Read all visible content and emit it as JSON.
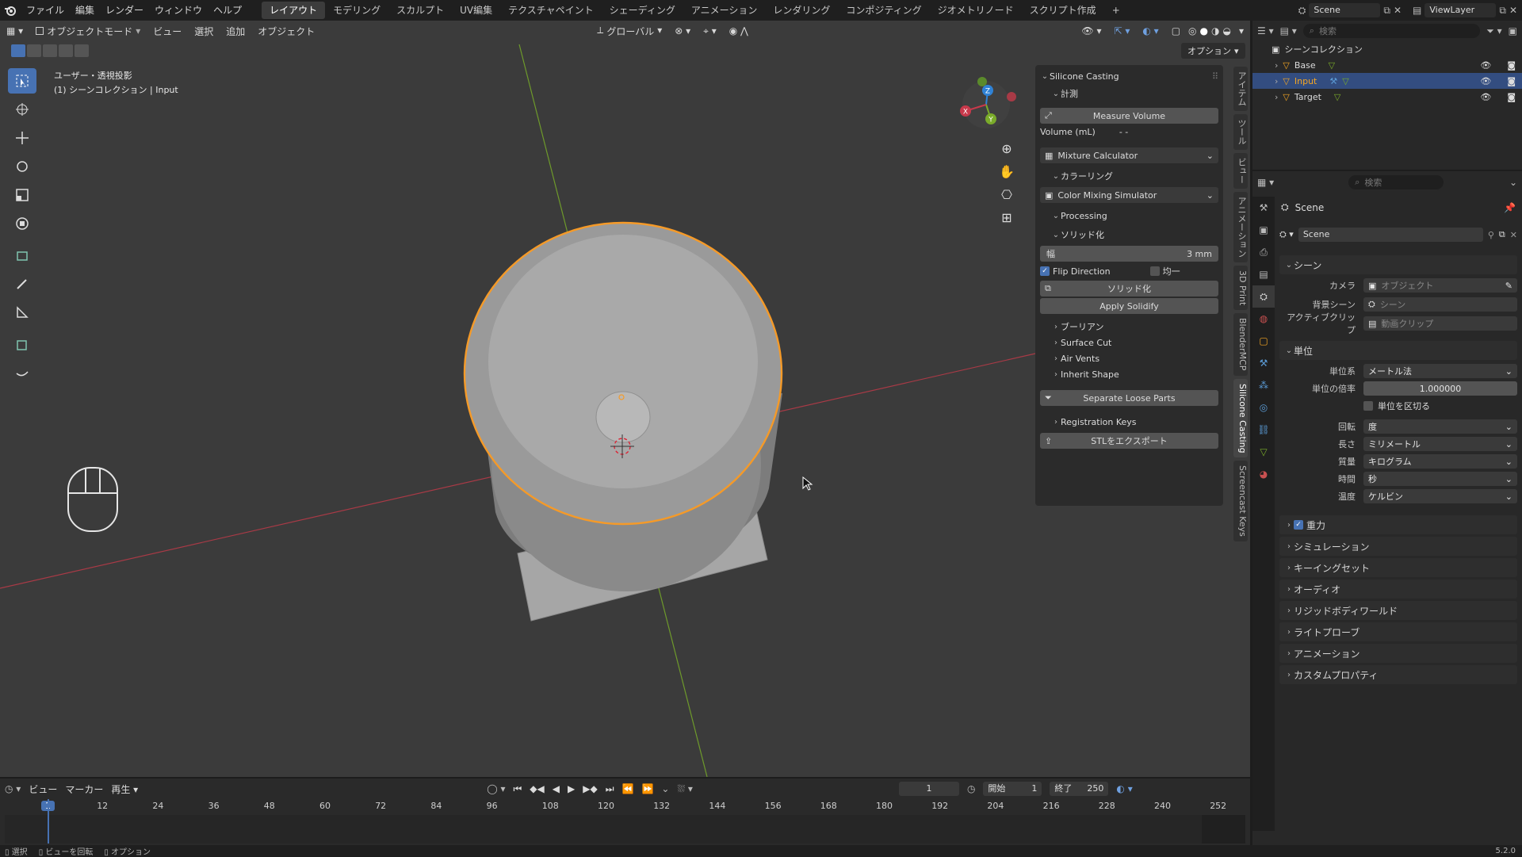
{
  "app": {
    "version": "5.2.0"
  },
  "menus": [
    "ファイル",
    "編集",
    "レンダー",
    "ウィンドウ",
    "ヘルプ"
  ],
  "workspaces": [
    "レイアウト",
    "モデリング",
    "スカルプト",
    "UV編集",
    "テクスチャペイント",
    "シェーディング",
    "アニメーション",
    "レンダリング",
    "コンポジティング",
    "ジオメトリノード",
    "スクリプト作成"
  ],
  "scene_selector": {
    "scene": "Scene",
    "view_layer": "ViewLayer"
  },
  "viewport": {
    "mode": "オブジェクトモード",
    "menus": [
      "ビュー",
      "選択",
      "追加",
      "オブジェクト"
    ],
    "transform_orientation": "グローバル",
    "options_label": "オプション",
    "overlay_line1": "ユーザー・透視投影",
    "overlay_line2": "(1) シーンコレクション | Input",
    "axes": {
      "x": "X",
      "y": "Y",
      "z": "Z"
    }
  },
  "npanel": {
    "title": "Silicone Casting",
    "sections": {
      "measure": "計測",
      "measure_button": "Measure Volume",
      "volume_label": "Volume (mL)",
      "volume_value": "- -",
      "mixture": "Mixture Calculator",
      "coloring": "カラーリング",
      "color_sim": "Color Mixing Simulator",
      "processing": "Processing",
      "solidify": "ソリッド化",
      "width_label": "幅",
      "width_value": "3 mm",
      "flip_direction": "Flip Direction",
      "uniform": "均一",
      "solidify_button": "ソリッド化",
      "apply_solidify": "Apply Solidify",
      "boolean": "ブーリアン",
      "surface_cut": "Surface Cut",
      "air_vents": "Air Vents",
      "inherit_shape": "Inherit Shape",
      "separate_loose": "Separate Loose Parts",
      "registration_keys": "Registration Keys",
      "stl_export": "STLをエクスポート"
    },
    "tabs": [
      "アイテム",
      "ツール",
      "ビュー",
      "アニメーション",
      "3D Print",
      "BlenderMCP",
      "Silicone Casting",
      "Screencast Keys"
    ]
  },
  "outliner": {
    "search_placeholder": "検索",
    "collection": "シーンコレクション",
    "items": [
      "Base",
      "Input",
      "Target"
    ]
  },
  "properties": {
    "search_placeholder": "検索",
    "breadcrumb": "Scene",
    "scene_name": "Scene",
    "scene_section": "シーン",
    "camera_label": "カメラ",
    "camera_value": "オブジェクト",
    "bg_scene_label": "背景シーン",
    "bg_scene_value": "シーン",
    "active_clip_label": "アクティブクリップ",
    "active_clip_value": "動画クリップ",
    "units_section": "単位",
    "unit_system_label": "単位系",
    "unit_system_value": "メートル法",
    "unit_scale_label": "単位の倍率",
    "unit_scale_value": "1.000000",
    "separate_units": "単位を区切る",
    "rotation_label": "回転",
    "rotation_value": "度",
    "length_label": "長さ",
    "length_value": "ミリメートル",
    "mass_label": "質量",
    "mass_value": "キログラム",
    "time_label": "時間",
    "time_value": "秒",
    "temperature_label": "温度",
    "temperature_value": "ケルビン",
    "collapsed": [
      "重力",
      "シミュレーション",
      "キーイングセット",
      "オーディオ",
      "リジッドボディワールド",
      "ライトプローブ",
      "アニメーション",
      "カスタムプロパティ"
    ]
  },
  "timeline": {
    "menus": [
      "ビュー",
      "マーカー",
      "再生"
    ],
    "current_frame": "1",
    "start_label": "開始",
    "start": "1",
    "end_label": "終了",
    "end": "250",
    "ticks": [
      "1",
      "12",
      "24",
      "36",
      "48",
      "60",
      "72",
      "84",
      "96",
      "108",
      "120",
      "132",
      "144",
      "156",
      "168",
      "180",
      "192",
      "204",
      "216",
      "228",
      "240",
      "252"
    ]
  },
  "statusbar": {
    "select": "選択",
    "rotate_view": "ビューを回転",
    "options": "オプション"
  },
  "colors": {
    "accent": "#4772b3",
    "selection": "#f5a623",
    "x_axis": "#c8394b",
    "y_axis": "#7aab2a",
    "z_axis": "#2f82d6"
  }
}
